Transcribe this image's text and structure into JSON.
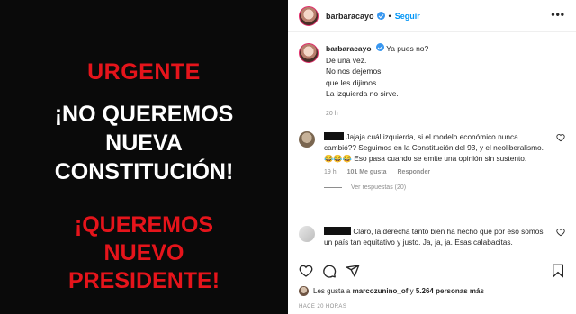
{
  "media": {
    "line1": "URGENTE",
    "line2": "¡NO QUEREMOS",
    "line3": "NUEVA",
    "line4": "CONSTITUCIÓN!",
    "line5": "¡QUEREMOS",
    "line6": "NUEVO",
    "line7": "PRESIDENTE!",
    "colors": {
      "red": "#e5141b",
      "white": "#ffffff",
      "background": "#0a0a0a"
    }
  },
  "header": {
    "username": "barbaracayo",
    "separator": "•",
    "follow_label": "Seguir",
    "more_icon": "more-horizontal-icon"
  },
  "caption": {
    "username": "barbaracayo",
    "lines": [
      "Ya pues no?",
      "De una vez.",
      "No nos dejemos.",
      "que les dijimos..",
      "La izquierda no sirve."
    ],
    "time": "20 h"
  },
  "comments": [
    {
      "text": "Jajaja cuál izquierda, si el modelo económico nunca cambió?? Seguimos en la Constitución del 93, y el neoliberalismo. 😂😂😂 Eso pasa cuando se emite una opinión sin sustento.",
      "time": "19 h",
      "likes": "101 Me gusta",
      "reply": "Responder",
      "view_replies": "Ver respuestas (20)"
    },
    {
      "text": "Claro, la derecha tanto bien ha hecho que por eso somos un país tan equitativo y justo. Ja, ja, ja. Esas calabacitas."
    }
  ],
  "likes": {
    "prefix": "Les gusta a",
    "user": "marcozunino_of",
    "middle": "y",
    "count": "5.264 personas más"
  },
  "posted_ago": "HACE 20 HORAS",
  "colors": {
    "accent": "#0095f6",
    "verified": "#3897f0",
    "muted": "#8e8e8e"
  }
}
